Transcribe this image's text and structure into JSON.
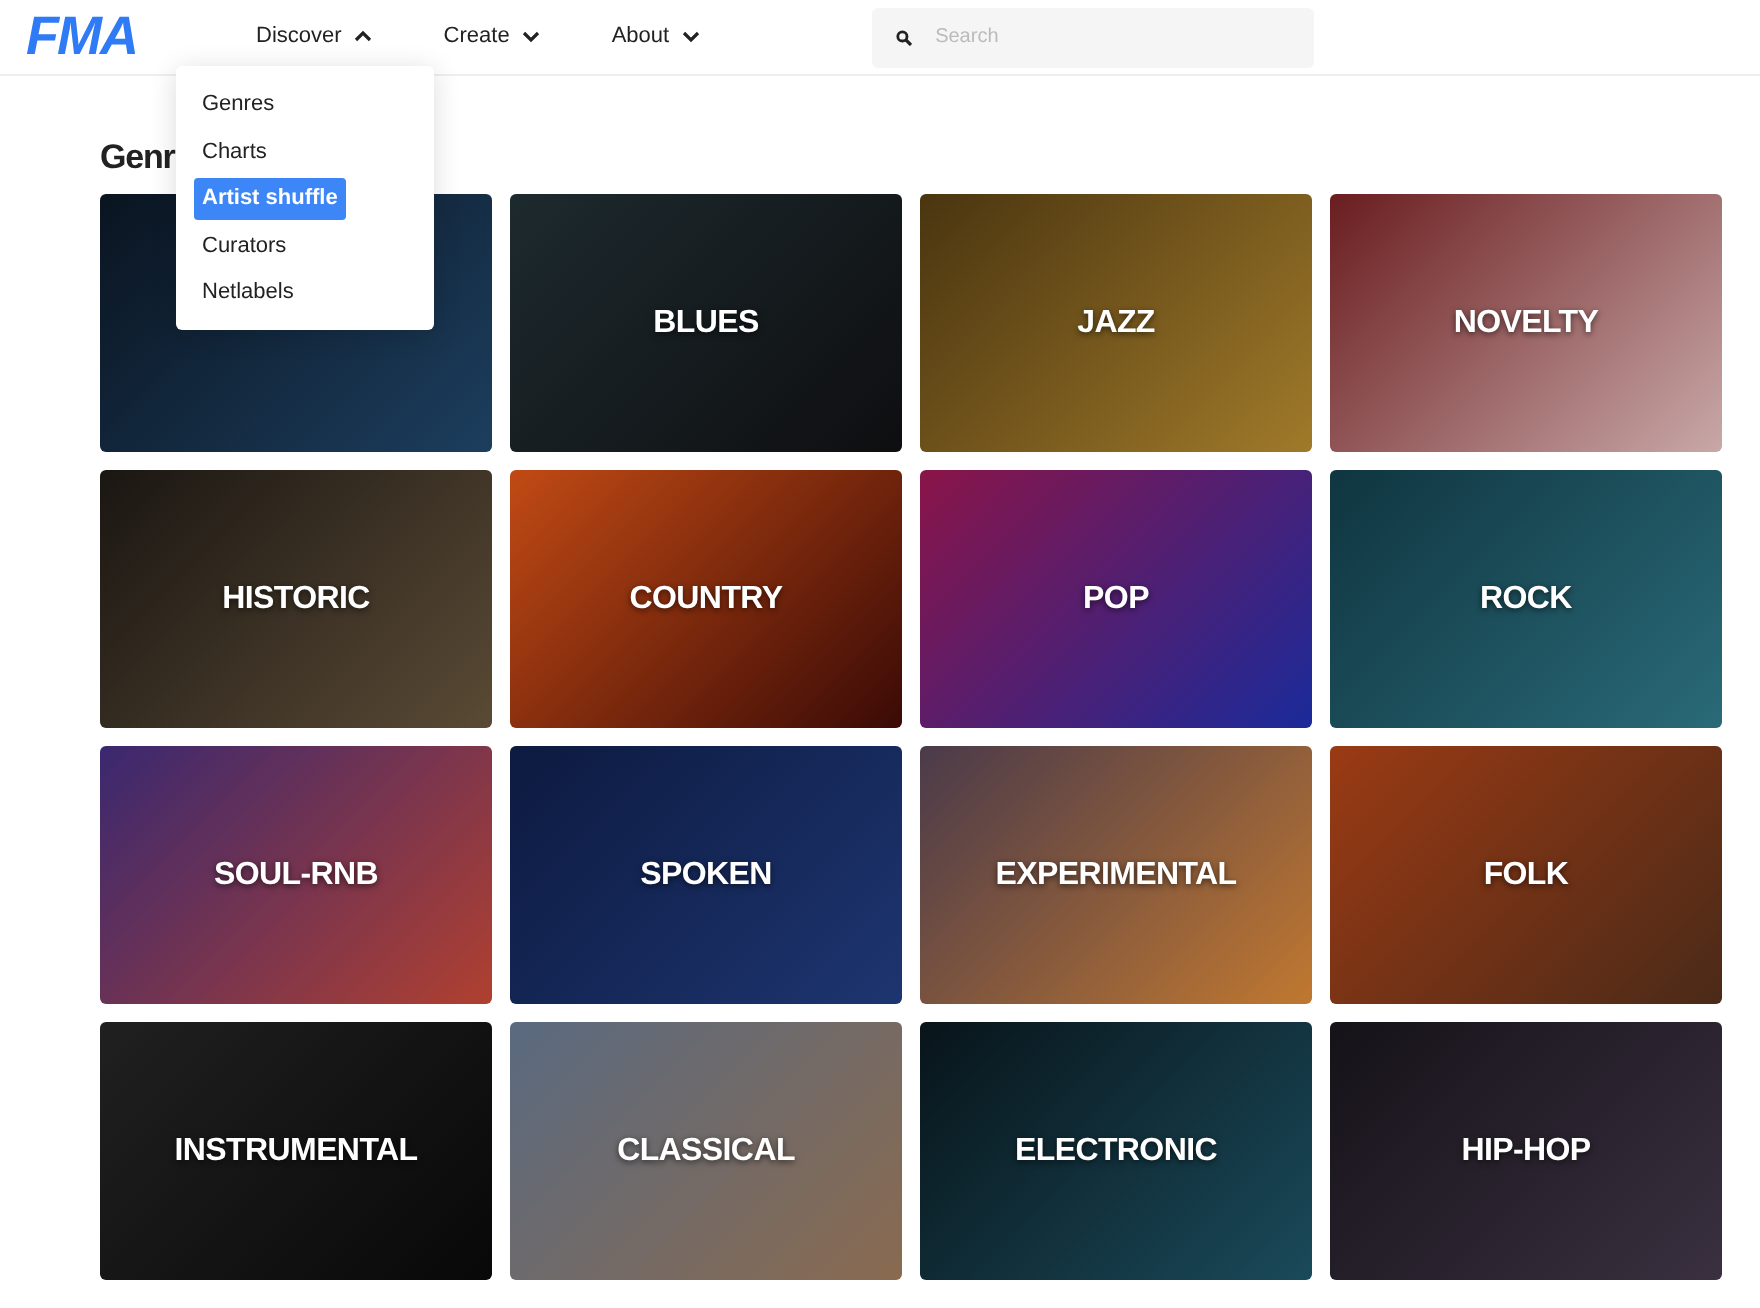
{
  "logo": "FMA",
  "nav": [
    {
      "label": "Discover",
      "expanded": true
    },
    {
      "label": "Create",
      "expanded": false
    },
    {
      "label": "About",
      "expanded": false
    }
  ],
  "search": {
    "placeholder": "Search"
  },
  "dropdown": [
    {
      "label": "Genres",
      "selected": false
    },
    {
      "label": "Charts",
      "selected": false
    },
    {
      "label": "Artist shuffle",
      "selected": true
    },
    {
      "label": "Curators",
      "selected": false
    },
    {
      "label": "Netlabels",
      "selected": false
    }
  ],
  "heading": "Genr",
  "genres": [
    {
      "kind": "hidden"
    },
    {
      "kind": "labeled",
      "label": "BLUES"
    },
    {
      "kind": "labeled",
      "label": "JAZZ"
    },
    {
      "kind": "labeled",
      "label": "NOVELTY"
    },
    {
      "kind": "labeled",
      "label": "HISTORIC"
    },
    {
      "kind": "labeled",
      "label": "COUNTRY"
    },
    {
      "kind": "labeled",
      "label": "POP"
    },
    {
      "kind": "labeled",
      "label": "ROCK"
    },
    {
      "kind": "labeled",
      "label": "SOUL-RNB"
    },
    {
      "kind": "labeled",
      "label": "SPOKEN"
    },
    {
      "kind": "labeled",
      "label": "EXPERIMENTAL"
    },
    {
      "kind": "labeled",
      "label": "FOLK"
    },
    {
      "kind": "labeled",
      "label": "INSTRUMENTAL"
    },
    {
      "kind": "labeled",
      "label": "CLASSICAL"
    },
    {
      "kind": "labeled",
      "label": "ELECTRONIC"
    },
    {
      "kind": "labeled",
      "label": "HIP-HOP"
    }
  ]
}
